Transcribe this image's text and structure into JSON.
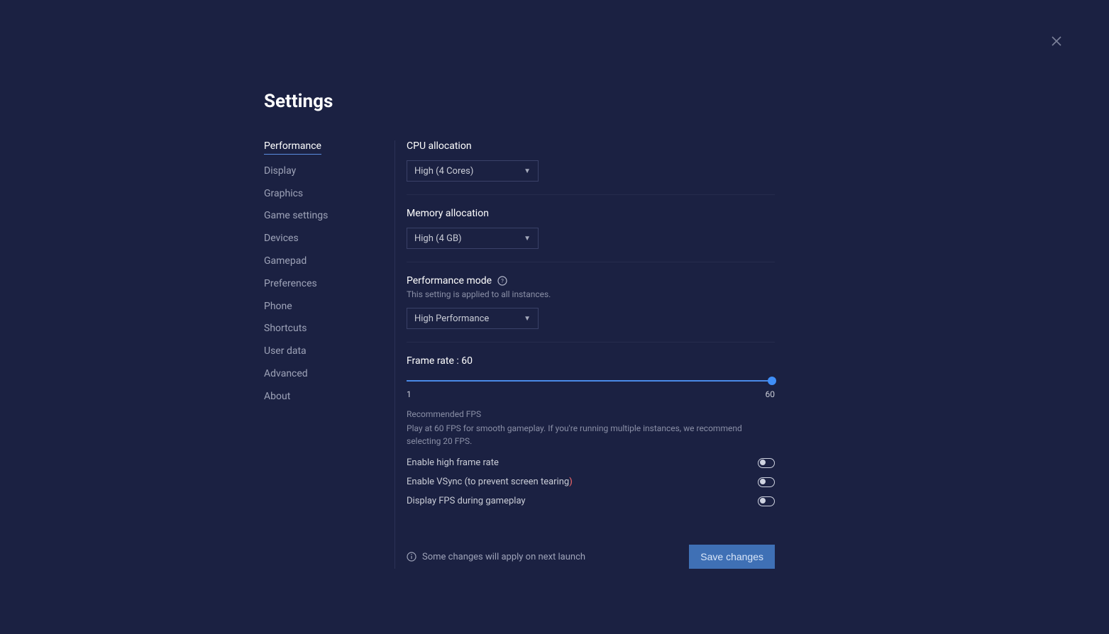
{
  "title": "Settings",
  "sidebar": {
    "items": [
      {
        "label": "Performance",
        "active": true
      },
      {
        "label": "Display"
      },
      {
        "label": "Graphics"
      },
      {
        "label": "Game settings"
      },
      {
        "label": "Devices"
      },
      {
        "label": "Gamepad"
      },
      {
        "label": "Preferences"
      },
      {
        "label": "Phone"
      },
      {
        "label": "Shortcuts"
      },
      {
        "label": "User data"
      },
      {
        "label": "Advanced"
      },
      {
        "label": "About"
      }
    ]
  },
  "cpu": {
    "label": "CPU allocation",
    "value": "High (4 Cores)"
  },
  "memory": {
    "label": "Memory allocation",
    "value": "High (4 GB)"
  },
  "perfmode": {
    "label": "Performance mode",
    "sub": "This setting is applied to all instances.",
    "value": "High Performance"
  },
  "framerate": {
    "label": "Frame rate : 60",
    "min": "1",
    "max": "60",
    "hint_title": "Recommended FPS",
    "hint_body": "Play at 60 FPS for smooth gameplay. If you're running multiple instances, we recommend selecting 20 FPS."
  },
  "toggles": {
    "high_frame": "Enable high frame rate",
    "vsync_prefix": "Enable VSync (to prevent screen tearing",
    "vsync_suffix": ")",
    "display_fps": "Display FPS during gameplay"
  },
  "footer": {
    "note": "Some changes will apply on next launch",
    "save": "Save changes"
  }
}
